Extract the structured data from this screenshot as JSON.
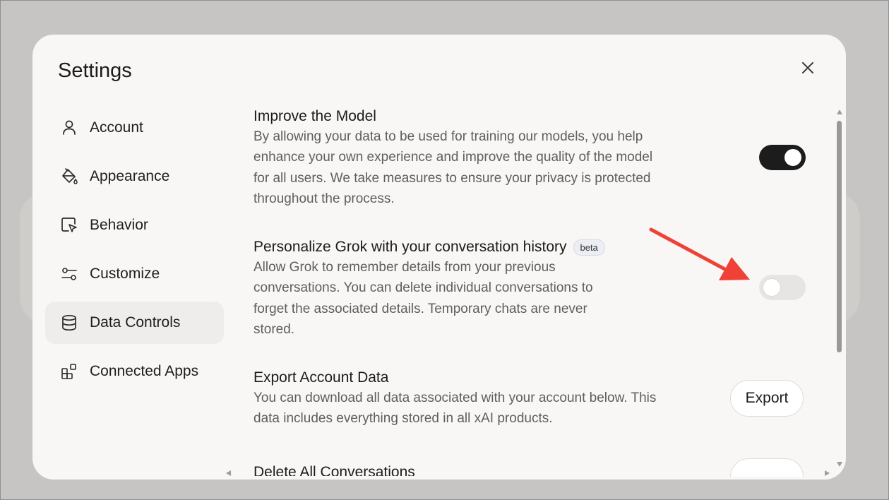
{
  "dialog": {
    "title": "Settings",
    "close_icon": "close-icon"
  },
  "sidebar": {
    "items": [
      {
        "label": "Account",
        "icon": "user-icon",
        "active": false
      },
      {
        "label": "Appearance",
        "icon": "paint-bucket-icon",
        "active": false
      },
      {
        "label": "Behavior",
        "icon": "cursor-window-icon",
        "active": false
      },
      {
        "label": "Customize",
        "icon": "sliders-icon",
        "active": false
      },
      {
        "label": "Data Controls",
        "icon": "database-icon",
        "active": true
      },
      {
        "label": "Connected Apps",
        "icon": "apps-grid-icon",
        "active": false
      }
    ]
  },
  "sections": {
    "improve_model": {
      "title": "Improve the Model",
      "description": "By allowing your data to be used for training our models, you help enhance your own experience and improve the quality of the model for all users. We take measures to ensure your privacy is protected throughout the process.",
      "toggle_on": true
    },
    "personalize": {
      "title": "Personalize Grok with your conversation history",
      "badge": "beta",
      "description": "Allow Grok to remember details from your previous conversations. You can delete individual conversations to forget the associated details. Temporary chats are never stored.",
      "toggle_on": false
    },
    "export": {
      "title": "Export Account Data",
      "description": "You can download all data associated with your account below. This data includes everything stored in all xAI products.",
      "button_label": "Export"
    },
    "delete_all": {
      "title": "Delete All Conversations"
    }
  },
  "colors": {
    "annotation_arrow": "#ef4136",
    "toggle_on": "#1c1c1c",
    "toggle_off": "#e6e5e3",
    "modal_bg": "#f8f7f5",
    "backdrop": "#c6c5c3"
  }
}
